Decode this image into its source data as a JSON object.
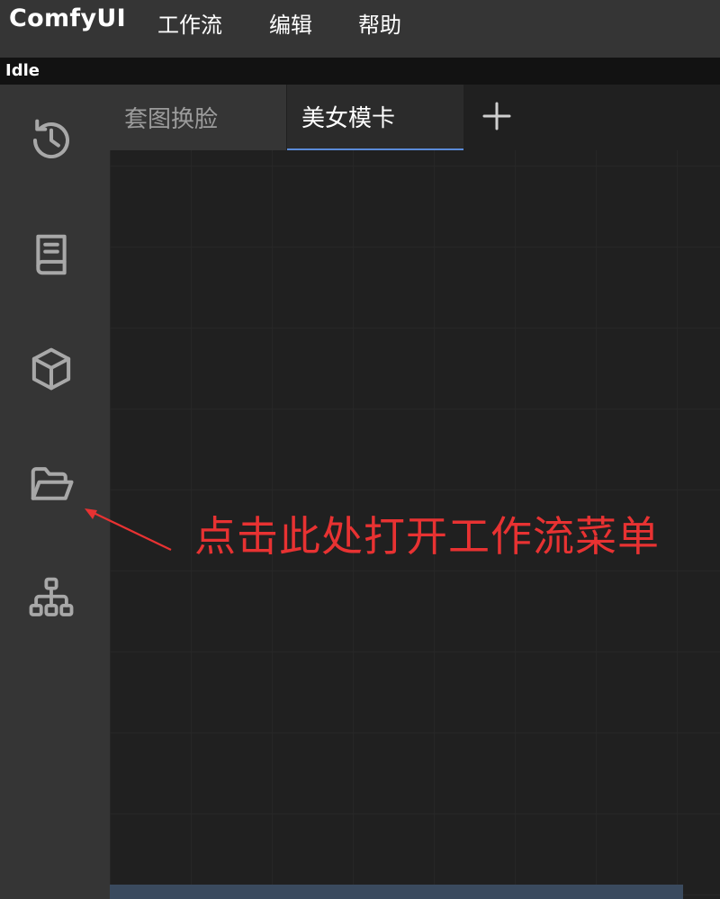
{
  "app": {
    "title": "ComfyUI"
  },
  "menu": {
    "items": [
      {
        "label": "工作流"
      },
      {
        "label": "编辑"
      },
      {
        "label": "帮助"
      }
    ]
  },
  "status": {
    "text": "Idle"
  },
  "sidebar": {
    "items": [
      {
        "icon": "history-icon"
      },
      {
        "icon": "book-icon"
      },
      {
        "icon": "cube-icon"
      },
      {
        "icon": "folder-open-icon"
      },
      {
        "icon": "sitemap-icon"
      }
    ]
  },
  "tabs": [
    {
      "label": "套图换脸",
      "active": false
    },
    {
      "label": "美女模卡",
      "active": true
    }
  ],
  "tab_add": {
    "icon": "plus-icon"
  },
  "annotation": {
    "text": "点击此处打开工作流菜单",
    "color": "#e83232"
  },
  "colors": {
    "accent": "#5b8bd8",
    "topbar": "#353535",
    "canvas": "#202020"
  }
}
